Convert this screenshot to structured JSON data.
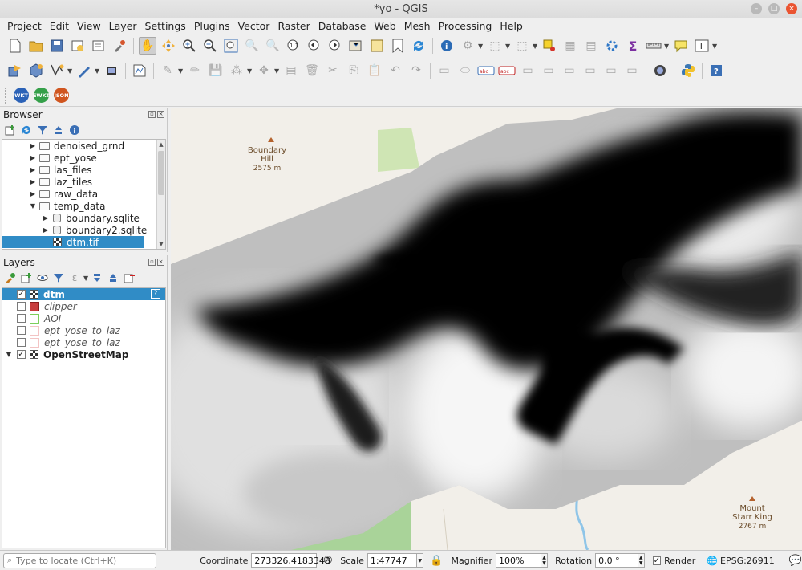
{
  "window": {
    "title": "*yo - QGIS",
    "buttons": [
      "–",
      "□",
      "×"
    ]
  },
  "menus": [
    "Project",
    "Edit",
    "View",
    "Layer",
    "Settings",
    "Plugins",
    "Vector",
    "Raster",
    "Database",
    "Web",
    "Mesh",
    "Processing",
    "Help"
  ],
  "plugins": {
    "wkt": "WKT",
    "ewkt": "EWKT",
    "json": "JSON"
  },
  "browser": {
    "title": "Browser",
    "items": [
      {
        "label": "denoised_grnd"
      },
      {
        "label": "ept_yose"
      },
      {
        "label": "las_files"
      },
      {
        "label": "laz_tiles"
      },
      {
        "label": "raw_data"
      },
      {
        "label": "temp_data"
      },
      {
        "label": "boundary.sqlite"
      },
      {
        "label": "boundary2.sqlite"
      },
      {
        "label": "dtm.tif"
      }
    ]
  },
  "layers": {
    "title": "Layers",
    "items": [
      {
        "label": "dtm",
        "checked": "✓"
      },
      {
        "label": "clipper",
        "color": "#c83c3c"
      },
      {
        "label": "AOI",
        "color": "#7ccf5a"
      },
      {
        "label": "ept_yose_to_laz",
        "color": "#f3c4c4"
      },
      {
        "label": "ept_yose_to_laz",
        "color": "#f3c4c4"
      },
      {
        "label": "OpenStreetMap",
        "checked": "✓"
      }
    ],
    "help_badge": "?"
  },
  "map": {
    "labels": [
      {
        "name": "Boundary",
        "sub": "Hill",
        "elev": "2575 m"
      },
      {
        "name": "Mount",
        "sub": "Starr King",
        "elev": "2767 m"
      }
    ]
  },
  "status": {
    "locator_placeholder": "Type to locate (Ctrl+K)",
    "coordinate_label": "Coordinate",
    "coordinate_value": "273326,4183348",
    "scale_label": "Scale",
    "scale_value": "1:47747",
    "magnifier_label": "Magnifier",
    "magnifier_value": "100%",
    "rotation_label": "Rotation",
    "rotation_value": "0,0 °",
    "render_label": "Render",
    "render_checked": "✓",
    "crs": "EPSG:26911"
  }
}
